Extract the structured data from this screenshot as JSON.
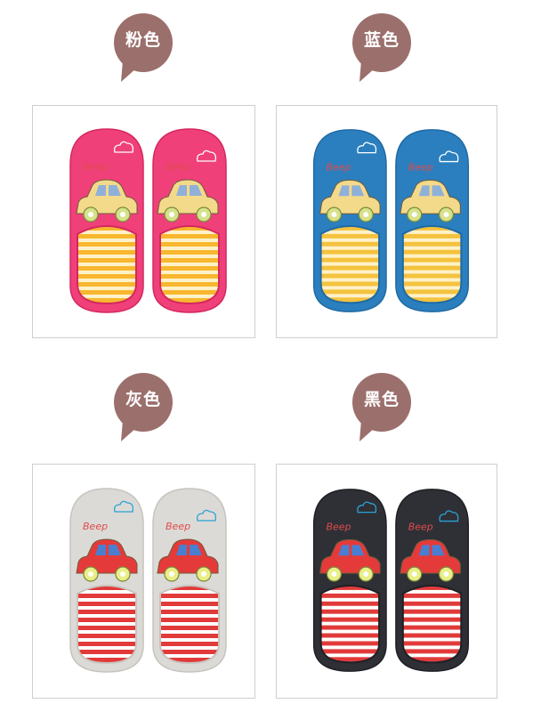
{
  "variants": [
    {
      "label": "粉色",
      "embroidery": "Beep",
      "upper": "#f0407a",
      "upperDark": "#d4285f",
      "liningA": "#f7b72e",
      "liningB": "#fff1c9",
      "car": "#f3d98a",
      "window": "#8fb0d9",
      "wheel": "#d6e28a",
      "cloud": "#ffffff"
    },
    {
      "label": "蓝色",
      "embroidery": "Beep",
      "upper": "#2b7fbe",
      "upperDark": "#1f6aa4",
      "liningA": "#f4c23d",
      "liningB": "#fff1c9",
      "car": "#f3d98a",
      "window": "#8fb0d9",
      "wheel": "#d6e28a",
      "cloud": "#ffffff"
    },
    {
      "label": "灰色",
      "embroidery": "Beep",
      "upper": "#dcdad6",
      "upperDark": "#c7c4bf",
      "liningA": "#e23a3a",
      "liningB": "#ffffff",
      "car": "#e53a3a",
      "window": "#4a7fcf",
      "wheel": "#e9ee86",
      "cloud": "#2aa3d6"
    },
    {
      "label": "黑色",
      "embroidery": "Beep",
      "upper": "#2e3036",
      "upperDark": "#1f2025",
      "liningA": "#e23a3a",
      "liningB": "#ffffff",
      "car": "#e53a3a",
      "window": "#4a7fcf",
      "wheel": "#e9ee86",
      "cloud": "#2aa3d6"
    }
  ],
  "bubbleColor": "#9b6f6c"
}
